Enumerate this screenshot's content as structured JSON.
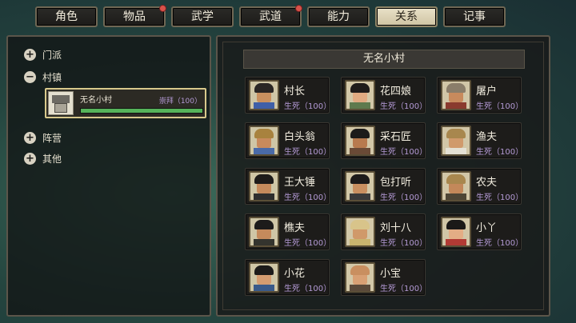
{
  "tabs": [
    {
      "label": "角色",
      "active": false,
      "dot": false
    },
    {
      "label": "物品",
      "active": false,
      "dot": true
    },
    {
      "label": "武学",
      "active": false,
      "dot": false
    },
    {
      "label": "武道",
      "active": false,
      "dot": true
    },
    {
      "label": "能力",
      "active": false,
      "dot": false
    },
    {
      "label": "关系",
      "active": true,
      "dot": false
    },
    {
      "label": "记事",
      "active": false,
      "dot": false
    }
  ],
  "tree": {
    "items": [
      {
        "label": "门派",
        "toggle": "+"
      },
      {
        "label": "村镇",
        "toggle": "−"
      },
      {
        "label": "阵营",
        "toggle": "+"
      },
      {
        "label": "其他",
        "toggle": "+"
      }
    ],
    "selected_village": {
      "name": "无名小村",
      "relation": "崇拜（100）",
      "progress": 1.0
    }
  },
  "panel": {
    "title": "无名小村",
    "characters": [
      {
        "name": "村长",
        "relation": "生死（100）",
        "hair": "#2a2624",
        "skin": "#c9905f",
        "cloth": "#3f5fa8",
        "bg": "#cfc6a6"
      },
      {
        "name": "花四娘",
        "relation": "生死（100）",
        "hair": "#1f1c1b",
        "skin": "#e0aa82",
        "cloth": "#5e7a4e",
        "bg": "#d3c8a8"
      },
      {
        "name": "屠户",
        "relation": "生死（100）",
        "hair": "#8a7d6a",
        "skin": "#c88a5d",
        "cloth": "#8a3a2e",
        "bg": "#d1c6a7"
      },
      {
        "name": "白头翁",
        "relation": "生死（100）",
        "hair": "#a8823e",
        "skin": "#c88a5d",
        "cloth": "#4a6aa8",
        "bg": "#cfc6a6"
      },
      {
        "name": "采石匠",
        "relation": "生死（100）",
        "hair": "#1d1b1a",
        "skin": "#b87a4e",
        "cloth": "#6a4a36",
        "bg": "#d3c8a8"
      },
      {
        "name": "渔夫",
        "relation": "生死（100）",
        "hair": "#a8874e",
        "skin": "#d09a6c",
        "cloth": "#e4e0d4",
        "bg": "#d1c6a7"
      },
      {
        "name": "王大锤",
        "relation": "生死（100）",
        "hair": "#1d1b1a",
        "skin": "#c58a5c",
        "cloth": "#2e2e2e",
        "bg": "#cfc6a6"
      },
      {
        "name": "包打听",
        "relation": "生死（100）",
        "hair": "#1d1b1a",
        "skin": "#c98f60",
        "cloth": "#3a3a3a",
        "bg": "#d3c8a8"
      },
      {
        "name": "农夫",
        "relation": "生死（100）",
        "hair": "#a8874e",
        "skin": "#c3885a",
        "cloth": "#4e4636",
        "bg": "#d1c6a7"
      },
      {
        "name": "樵夫",
        "relation": "生死（100）",
        "hair": "#1d1b1a",
        "skin": "#c58a5c",
        "cloth": "#34342e",
        "bg": "#cfc6a6"
      },
      {
        "name": "刘十八",
        "relation": "生死（100）",
        "hair": "#d8c48a",
        "skin": "#d0996a",
        "cloth": "#c9b46e",
        "bg": "#d3c8a8"
      },
      {
        "name": "小丫",
        "relation": "生死（100）",
        "hair": "#1b1918",
        "skin": "#e3ad85",
        "cloth": "#b23a34",
        "bg": "#d1c6a7"
      },
      {
        "name": "小花",
        "relation": "生死（100）",
        "hair": "#1d1b1a",
        "skin": "#d59c70",
        "cloth": "#3a5a8a",
        "bg": "#cfc6a6"
      },
      {
        "name": "小宝",
        "relation": "生死（100）",
        "hair": "#c98f60",
        "skin": "#d8a074",
        "cloth": "#5a4a3a",
        "bg": "#d3c8a8"
      }
    ]
  }
}
